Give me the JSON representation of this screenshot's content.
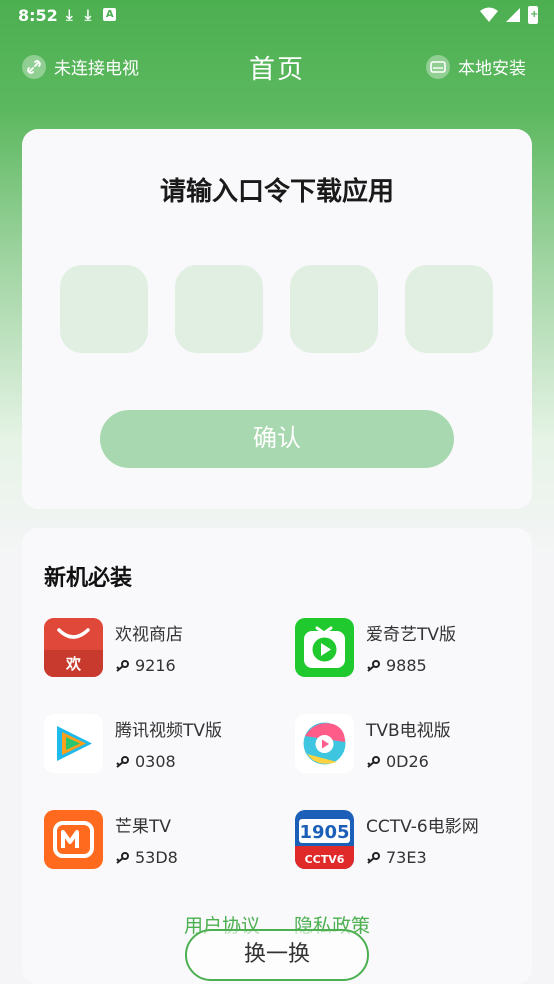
{
  "status_bar": {
    "time": "8:52",
    "battery_glyph": "+"
  },
  "header": {
    "tv_status": "未连接电视",
    "title": "首页",
    "local_install": "本地安装"
  },
  "code_entry": {
    "title": "请输入口令下载应用",
    "boxes": [
      "",
      "",
      "",
      ""
    ],
    "confirm_label": "确认"
  },
  "recommended": {
    "title": "新机必装",
    "apps": [
      {
        "name": "欢视商店",
        "code": "9216",
        "icon": "huanshi-store-icon"
      },
      {
        "name": "爱奇艺TV版",
        "code": "9885",
        "icon": "iqiyi-tv-icon"
      },
      {
        "name": "腾讯视频TV版",
        "code": "0308",
        "icon": "tencent-video-icon"
      },
      {
        "name": "TVB电视版",
        "code": "0D26",
        "icon": "tvb-icon"
      },
      {
        "name": "芒果TV",
        "code": "53D8",
        "icon": "mango-tv-icon"
      },
      {
        "name": "CCTV-6电影网",
        "code": "73E3",
        "icon": "cctv6-icon"
      }
    ]
  },
  "footer": {
    "user_agreement": "用户协议",
    "privacy_policy": "隐私政策",
    "swap_label": "换一换"
  },
  "colors": {
    "brand_green": "#4caf50",
    "code_box": "#e0efe2",
    "confirm_disabled": "#a8d8b0"
  }
}
